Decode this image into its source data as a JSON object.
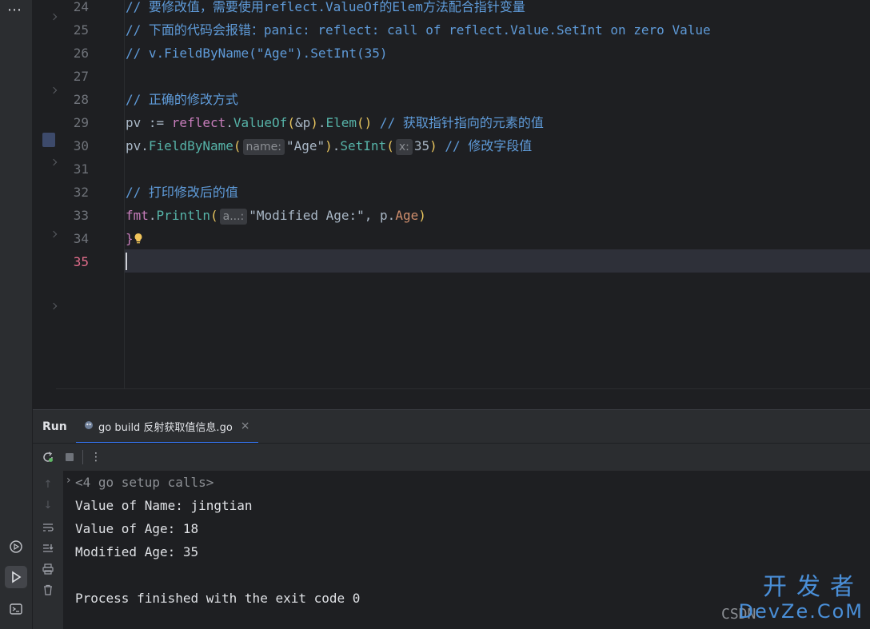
{
  "activity": {
    "more_label": "⋯"
  },
  "editor": {
    "current_line": "35",
    "lines": [
      {
        "no": "24",
        "segments": [
          {
            "t": "// 要修改值，需要使用reflect.ValueOf的Elem方法配合指针变量",
            "c": "c-cm"
          }
        ]
      },
      {
        "no": "25",
        "segments": [
          {
            "t": "// 下面的代码会报错：panic: reflect: call of reflect.Value.SetInt on zero Value",
            "c": "c-cm"
          }
        ]
      },
      {
        "no": "26",
        "segments": [
          {
            "t": "// v.FieldByName(\"Age\").SetInt(35)",
            "c": "c-cm"
          }
        ]
      },
      {
        "no": "27",
        "segments": []
      },
      {
        "no": "28",
        "segments": [
          {
            "t": "// 正确的修改方式",
            "c": "c-cm"
          }
        ]
      },
      {
        "no": "29",
        "segments": [
          {
            "t": "pv := ",
            "c": "c-var"
          },
          {
            "t": "reflect",
            "c": "c-pkg"
          },
          {
            "t": ".",
            "c": "c-var"
          },
          {
            "t": "ValueOf",
            "c": "c-grn"
          },
          {
            "t": "(",
            "c": "c-bk"
          },
          {
            "t": "&p",
            "c": "c-var"
          },
          {
            "t": ")",
            "c": "c-bk"
          },
          {
            "t": ".",
            "c": "c-var"
          },
          {
            "t": "Elem",
            "c": "c-grn"
          },
          {
            "t": "()",
            "c": "c-bk"
          },
          {
            "t": " // 获取指针指向的元素的值",
            "c": "c-cm"
          }
        ]
      },
      {
        "no": "30",
        "segments": [
          {
            "t": "pv.",
            "c": "c-var"
          },
          {
            "t": "FieldByName",
            "c": "c-grn"
          },
          {
            "t": "(",
            "c": "c-bk"
          },
          {
            "hint": "name:"
          },
          {
            "t": "\"Age\"",
            "c": "c-var"
          },
          {
            "t": ")",
            "c": "c-bk"
          },
          {
            "t": ".",
            "c": "c-var"
          },
          {
            "t": "SetInt",
            "c": "c-grn"
          },
          {
            "t": "(",
            "c": "c-bk"
          },
          {
            "hint": "x:"
          },
          {
            "t": "35",
            "c": "c-var"
          },
          {
            "t": ")",
            "c": "c-bk"
          },
          {
            "t": " // 修改字段值",
            "c": "c-cm"
          }
        ]
      },
      {
        "no": "31",
        "segments": []
      },
      {
        "no": "32",
        "segments": [
          {
            "t": "// 打印修改后的值",
            "c": "c-cm"
          }
        ]
      },
      {
        "no": "33",
        "segments": [
          {
            "t": "fmt",
            "c": "c-pkg"
          },
          {
            "t": ".",
            "c": "c-var"
          },
          {
            "t": "Println",
            "c": "c-grn"
          },
          {
            "t": "(",
            "c": "c-bk"
          },
          {
            "hint": "a...:"
          },
          {
            "t": "\"Modified Age:\"",
            "c": "c-var"
          },
          {
            "t": ", p.",
            "c": "c-var"
          },
          {
            "t": "Age",
            "c": "c-kw"
          },
          {
            "t": ")",
            "c": "c-bk"
          }
        ]
      },
      {
        "no": "34",
        "segments": [
          {
            "t": "}",
            "c": "c-bk2"
          }
        ]
      },
      {
        "no": "35",
        "segments": []
      }
    ]
  },
  "run_panel": {
    "title": "Run",
    "tab_label": "go build 反射获取值信息.go",
    "tab_close": "×",
    "toolbar": {
      "rerun_icon": "rerun-icon",
      "stop_icon": "stop-icon",
      "menu_label": "⋮"
    },
    "console": {
      "lines": [
        {
          "text": "<4 go setup calls>",
          "gray": true
        },
        {
          "text": "Value of Name: jingtian",
          "gray": false
        },
        {
          "text": "Value of Age: 18",
          "gray": false
        },
        {
          "text": "Modified Age: 35",
          "gray": false
        },
        {
          "text": "",
          "gray": false
        },
        {
          "text": "Process finished with the exit code 0",
          "gray": false
        }
      ],
      "fold_glyph": "›"
    }
  },
  "watermark": {
    "cn": "开发者",
    "en": "DevZe.CoM",
    "csdn": "CSDN"
  },
  "colors": {
    "accent": "#3574f0",
    "background": "#1e1f22",
    "panel": "#2b2d30"
  }
}
